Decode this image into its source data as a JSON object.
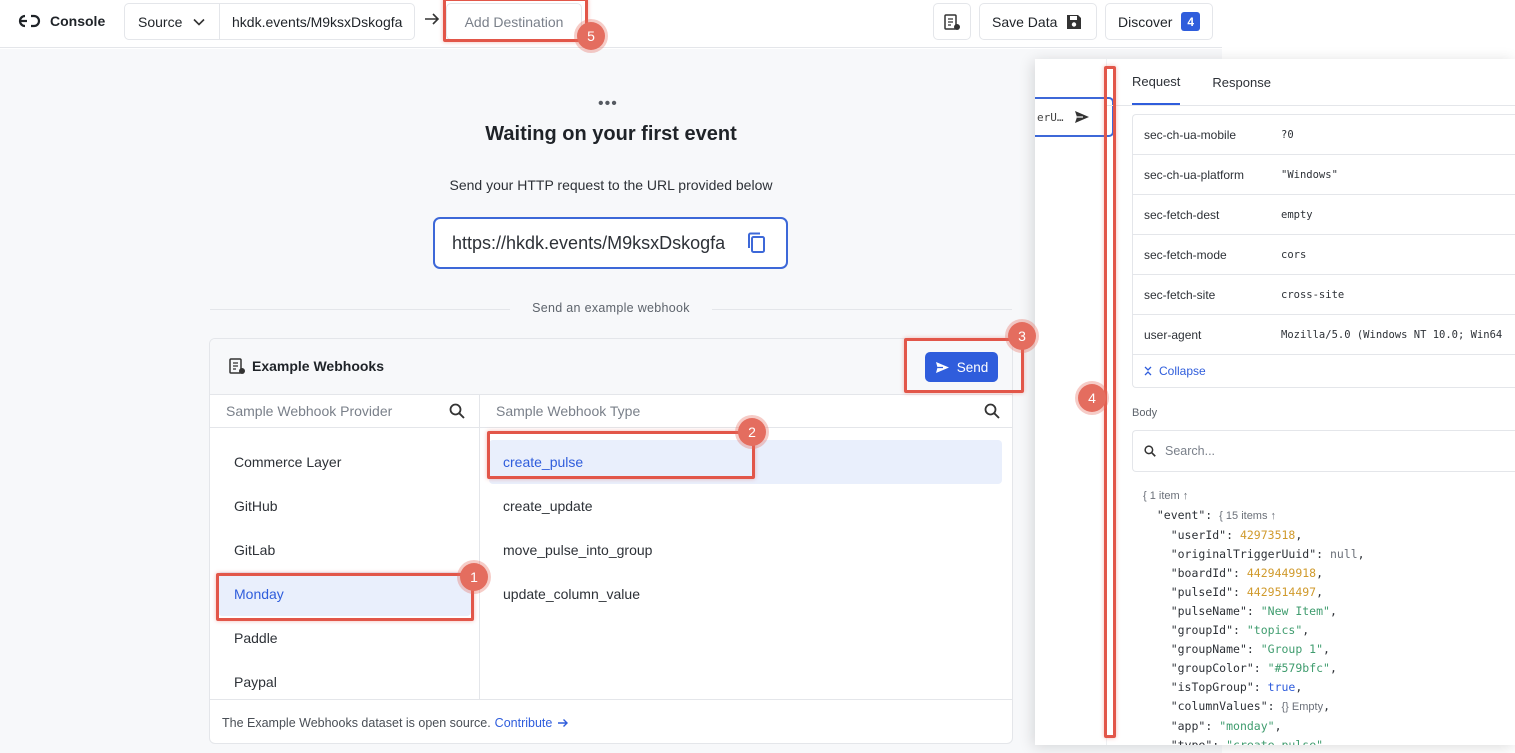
{
  "topbar": {
    "logo_text": "Console",
    "source_label": "Source",
    "source_url": "hkdk.events/M9ksxDskogfa",
    "add_destination": "Add Destination",
    "save_label": "Save Data",
    "discover_label": "Discover",
    "discover_count": "4"
  },
  "main": {
    "title": "Waiting on your first event",
    "subtitle": "Send your HTTP request to the URL provided below",
    "url": "https://hkdk.events/M9ksxDskogfa",
    "divider_label": "Send an example webhook"
  },
  "webhooks": {
    "title": "Example Webhooks",
    "send_label": "Send",
    "provider_placeholder": "Sample Webhook Provider",
    "type_placeholder": "Sample Webhook Type",
    "providers": [
      "Commerce Layer",
      "GitHub",
      "GitLab",
      "Monday",
      "Paddle",
      "Paypal"
    ],
    "selected_provider": "Monday",
    "types": [
      "create_pulse",
      "create_update",
      "move_pulse_into_group",
      "update_column_value"
    ],
    "selected_type": "create_pulse",
    "footer_text": "The Example Webhooks dataset is open source.",
    "footer_link": "Contribute"
  },
  "panel": {
    "strip_text": "erU…",
    "tabs": [
      "Request",
      "Response"
    ],
    "active_tab": "Request",
    "headers": [
      {
        "key": "sec-ch-ua-mobile",
        "value": "?0"
      },
      {
        "key": "sec-ch-ua-platform",
        "value": "\"Windows\""
      },
      {
        "key": "sec-fetch-dest",
        "value": "empty"
      },
      {
        "key": "sec-fetch-mode",
        "value": "cors"
      },
      {
        "key": "sec-fetch-site",
        "value": "cross-site"
      },
      {
        "key": "user-agent",
        "value": "Mozilla/5.0 (Windows NT 10.0; Win64"
      }
    ],
    "collapse_label": "Collapse",
    "body_label": "Body",
    "search_placeholder": "Search...",
    "json_root_meta": "{ 1 item ↑",
    "json_event_meta": "{ 15 items ↑",
    "json_fields": [
      {
        "key": "userId",
        "value": "42973518",
        "type": "num"
      },
      {
        "key": "originalTriggerUuid",
        "value": "null",
        "type": "null"
      },
      {
        "key": "boardId",
        "value": "4429449918",
        "type": "num"
      },
      {
        "key": "pulseId",
        "value": "4429514497",
        "type": "num"
      },
      {
        "key": "pulseName",
        "value": "\"New Item\"",
        "type": "str"
      },
      {
        "key": "groupId",
        "value": "\"topics\"",
        "type": "str"
      },
      {
        "key": "groupName",
        "value": "\"Group 1\"",
        "type": "str"
      },
      {
        "key": "groupColor",
        "value": "\"#579bfc\"",
        "type": "str"
      },
      {
        "key": "isTopGroup",
        "value": "true",
        "type": "bool"
      },
      {
        "key": "columnValues",
        "value": "{} Empty",
        "type": "meta"
      },
      {
        "key": "app",
        "value": "\"monday\"",
        "type": "str"
      },
      {
        "key": "type",
        "value": "\"create_pulse\"",
        "type": "str"
      }
    ]
  },
  "annotations": [
    "1",
    "2",
    "3",
    "4",
    "5"
  ],
  "colors": {
    "accent": "#2f5ddc",
    "annotation": "#e25649",
    "selected_bg": "#e9effc"
  }
}
